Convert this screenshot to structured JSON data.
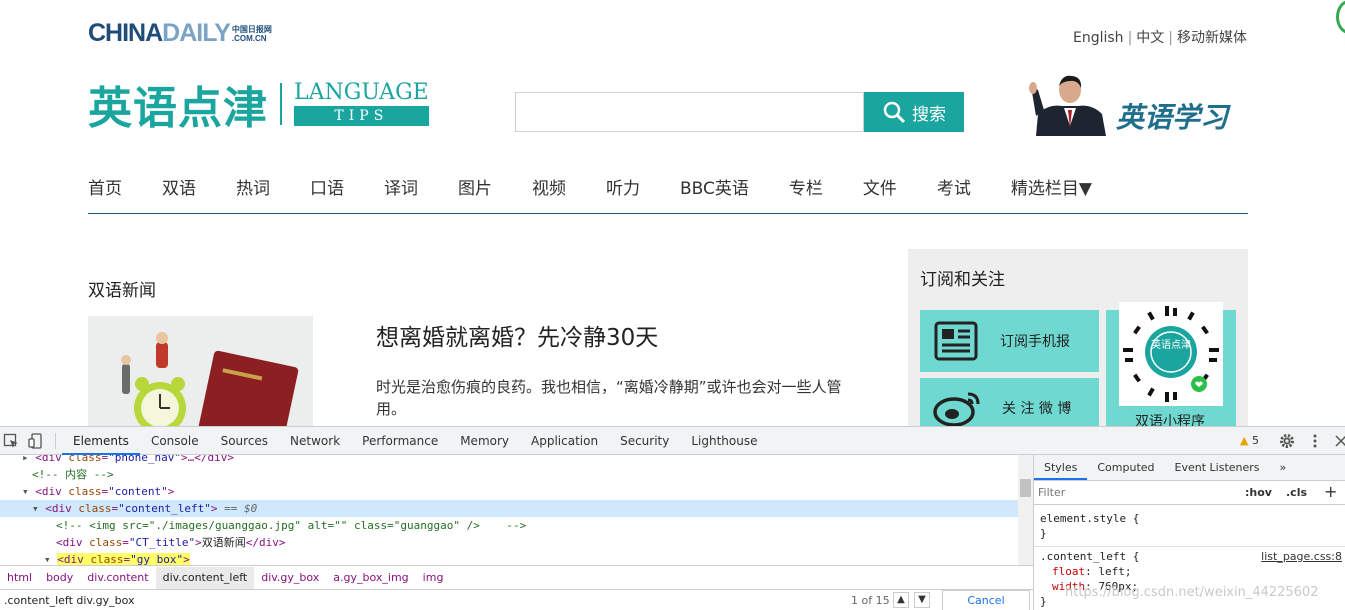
{
  "site": {
    "logo": {
      "china": "CHINA",
      "daily": "DAILY",
      "cn_mark": "中国日报网",
      "domain": ".COM.CN"
    },
    "lang_links": [
      "English",
      "中文",
      "移动新媒体"
    ],
    "brand": {
      "cn": "英语点津",
      "en_line1": "LANGUAGE",
      "en_line2": "TIPS"
    },
    "search": {
      "placeholder": "",
      "button": "搜索"
    },
    "promo_title": "英语学习",
    "nav": [
      "首页",
      "双语",
      "热词",
      "口语",
      "译词",
      "图片",
      "视频",
      "听力",
      "BBC英语",
      "专栏",
      "文件",
      "考试",
      "精选栏目▼"
    ],
    "section_title": "双语新闻",
    "article": {
      "title": "想离婚就离婚？先冷静30天",
      "desc": "时光是治愈伤痕的良药。我也相信，“离婚冷静期”或许也会对一些人管用。"
    },
    "sidebar": {
      "title": "订阅和关注",
      "tile1": "订阅手机报",
      "tile2": "关 注 微 博",
      "qr_label": "双语小程序",
      "qr_text": "英语点津"
    },
    "accent": "#1aa59e"
  },
  "devtools": {
    "tabs": [
      "Elements",
      "Console",
      "Sources",
      "Network",
      "Performance",
      "Memory",
      "Application",
      "Security",
      "Lighthouse"
    ],
    "active_tab": "Elements",
    "warnings": "5",
    "dom": {
      "l1": {
        "tag_open": "<div ",
        "attr": "class",
        "val": "\"phone_nav\"",
        "rest": ">…</div>"
      },
      "l2": "<!-- 内容 -->",
      "l3": {
        "tag_open": "<div ",
        "attr": "class",
        "val": "\"content\"",
        "rest": ">"
      },
      "l4": {
        "tag_open": "<div ",
        "attr": "class",
        "val": "\"content_left\"",
        "rest": ">",
        "marker": " == $0"
      },
      "l5": "<!-- <img src=\"./images/guanggao.jpg\" alt=\"\" class=\"guanggao\" />    -->",
      "l6": {
        "tag_open": "<div ",
        "attr": "class",
        "val": "\"CT_title\"",
        "rest": ">",
        "text": "双语新闻",
        "close": "</div>"
      },
      "l7": {
        "tag_open": "<div ",
        "attr": "class",
        "val": "\"gy_box\"",
        "rest": ">"
      }
    },
    "breadcrumbs": [
      "html",
      "body",
      "div.content",
      "div.content_left",
      "div.gy_box",
      "a.gy_box_img",
      "img"
    ],
    "active_crumb": "div.content_left",
    "search_query": ".content_left div.gy_box",
    "search_count": "1 of 15",
    "cancel": "Cancel",
    "styles": {
      "tabs": [
        "Styles",
        "Computed",
        "Event Listeners",
        "»"
      ],
      "filter_placeholder": "Filter",
      "hov": ":hov",
      "cls": ".cls",
      "plus": "+",
      "element_style": "element.style {",
      "element_close": "}",
      "rule_selector": ".content_left {",
      "rule_source": "list_page.css:8",
      "decl1_prop": "float",
      "decl1_val": "left;",
      "decl2_prop": "width",
      "decl2_val": "760px;",
      "rule_close": "}"
    },
    "watermark": "https://blog.csdn.net/weixin_44225602"
  }
}
